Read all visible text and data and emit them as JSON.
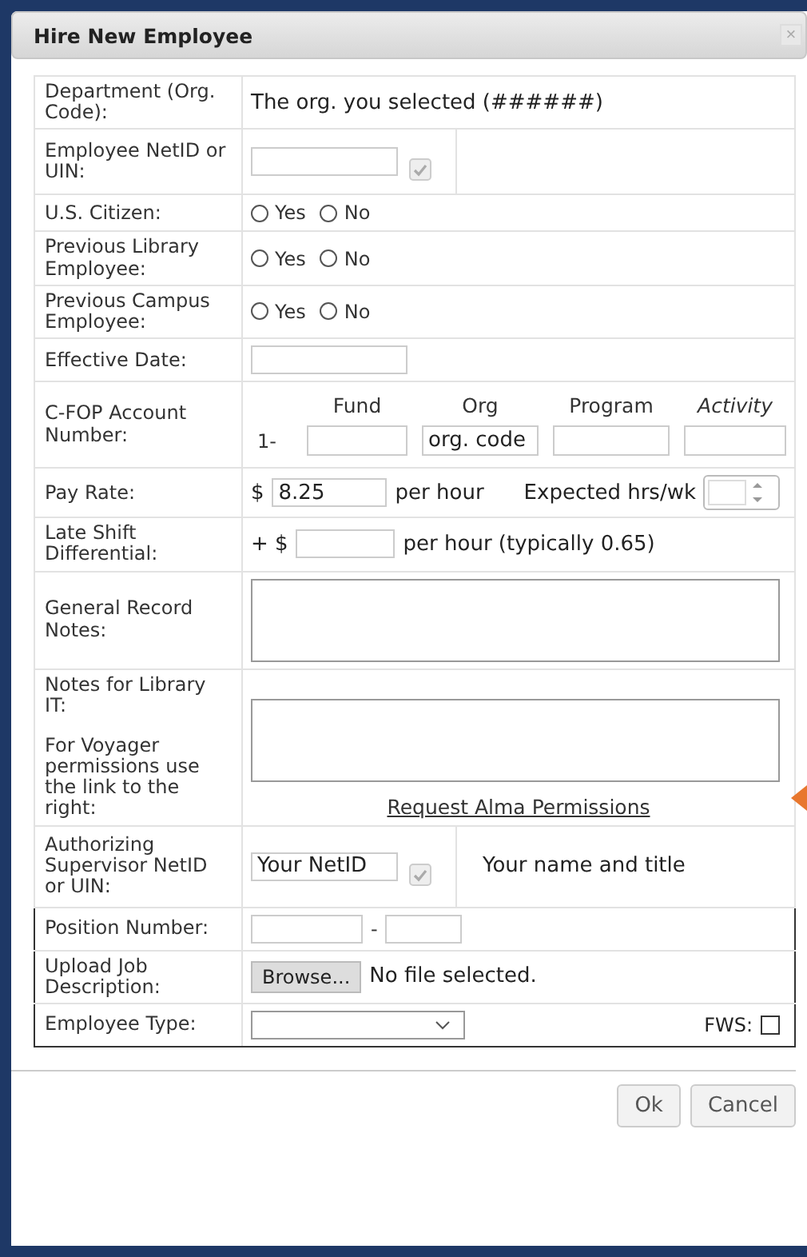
{
  "dialog": {
    "title": "Hire New Employee",
    "close": "×"
  },
  "rows": [
    {
      "kind": "text",
      "label": "Department (Org. Code):",
      "value": "The org. you selected (######)"
    },
    {
      "kind": "lookup",
      "label": "Employee NetID or UIN:"
    },
    {
      "kind": "radio",
      "label": "U.S. Citizen:",
      "options": [
        {
          "label": "Yes",
          "selected": false
        },
        {
          "label": "No",
          "selected": false
        }
      ]
    },
    {
      "kind": "radio",
      "label": "Previous Library Employee:",
      "options": [
        {
          "label": "Yes",
          "selected": false
        },
        {
          "label": "No",
          "selected": false
        }
      ]
    },
    {
      "kind": "radio",
      "label": "Previous Campus Employee:",
      "options": [
        {
          "label": "Yes",
          "selected": false
        },
        {
          "label": "No",
          "selected": false
        }
      ]
    },
    {
      "kind": "input",
      "label": "Effective Date:"
    },
    {
      "kind": "account",
      "label": "C-FOP Account Number:",
      "prefix": "1-",
      "parts": [
        {
          "heading": "Fund",
          "italic": false
        },
        {
          "heading": "Org",
          "italic": false,
          "value": "org. code"
        },
        {
          "heading": "Program",
          "italic": false
        },
        {
          "heading": "Activity",
          "italic": true
        }
      ]
    },
    {
      "kind": "pay",
      "label": "Pay Rate:",
      "prefix": "$",
      "value": "8.25",
      "unit": "per hour",
      "hours_label": "Expected hrs/wk"
    },
    {
      "kind": "extra",
      "label": "Late Shift Differential:",
      "prefix": "+ $",
      "unit": "per hour (typically 0.65)"
    },
    {
      "kind": "textarea",
      "label": "General Record Notes:"
    },
    {
      "kind": "textarea",
      "label": "Notes for Library IT:",
      "note": "For Voyager permissions use the link to the right:",
      "link": "Request Alma Permissions"
    },
    {
      "kind": "lookup",
      "label": "Authorizing Supervisor NetID or UIN:",
      "value": "Your NetID",
      "info": "Your name and title"
    },
    {
      "kind": "split",
      "label": "Position Number:",
      "separator": "-",
      "outlined": true
    },
    {
      "kind": "file",
      "label": "Upload Job Description:",
      "button": "Browse...",
      "status": "No file selected.",
      "outlined": true
    },
    {
      "kind": "select",
      "label": "Employee Type:",
      "flag_label": "FWS:",
      "checked": false,
      "outlined": true
    }
  ],
  "buttons": [
    "Ok",
    "Cancel"
  ]
}
